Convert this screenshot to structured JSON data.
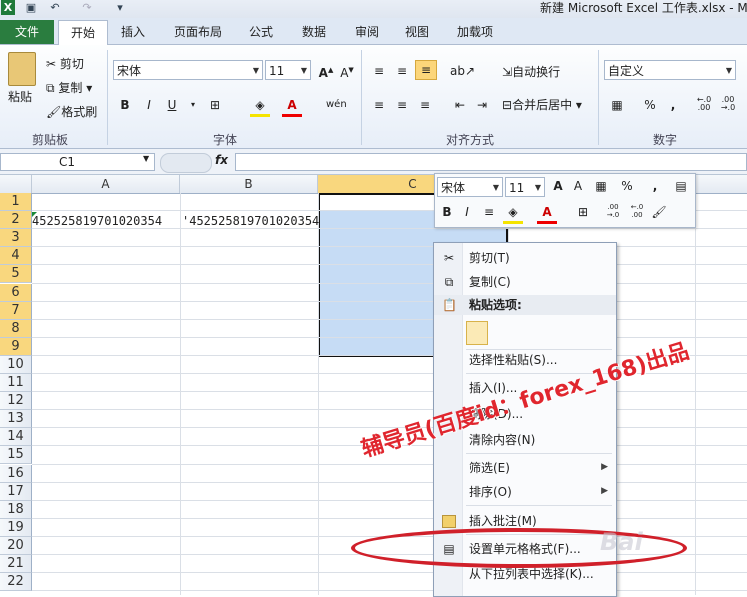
{
  "window": {
    "title": "新建 Microsoft Excel 工作表.xlsx - M"
  },
  "tabs": [
    "文件",
    "开始",
    "插入",
    "页面布局",
    "公式",
    "数据",
    "审阅",
    "视图",
    "加载项"
  ],
  "clipboard": {
    "paste": "粘贴",
    "cut": "剪切",
    "copy": "复制",
    "format_painter": "格式刷",
    "group": "剪贴板"
  },
  "font": {
    "name": "宋体",
    "size": "11",
    "group": "字体",
    "bold": "B",
    "italic": "I",
    "underline": "U",
    "wen": "wén"
  },
  "alignment": {
    "wrap": "自动换行",
    "merge": "合并后居中",
    "group": "对齐方式"
  },
  "number": {
    "format": "自定义",
    "group": "数字",
    "percent": "%",
    "comma": ",",
    "inc_dec": "+.0\n.00",
    "dec_dec": ".00\n→.0"
  },
  "formula_bar": {
    "name_box": "C1",
    "fx": "fx",
    "value": ""
  },
  "columns": [
    "A",
    "B",
    "C"
  ],
  "rows": [
    "1",
    "2",
    "3",
    "4",
    "5",
    "6",
    "7",
    "8",
    "9",
    "10",
    "11",
    "12",
    "13",
    "14",
    "15",
    "16",
    "17",
    "18",
    "19",
    "20",
    "21",
    "22"
  ],
  "cells": {
    "A2": "452525819701020354",
    "B2": "'452525819701020354"
  },
  "mini_toolbar": {
    "font": "宋体",
    "size": "11"
  },
  "context_menu": {
    "cut": "剪切(T)",
    "copy": "复制(C)",
    "paste_options": "粘贴选项:",
    "paste_special": "选择性粘贴(S)...",
    "insert": "插入(I)...",
    "delete": "删除(D)...",
    "clear": "清除内容(N)",
    "filter": "筛选(E)",
    "sort": "排序(O)",
    "insert_comment": "插入批注(M)",
    "format_cells": "设置单元格格式(F)...",
    "pick_list": "从下拉列表中选择(K)..."
  },
  "watermark": {
    "text": "辅导员(百度id：forex_168)出品"
  },
  "colors": {
    "file_tab": "#2a7d3f",
    "selection": "#c6dcf5",
    "row_highlight": "#f9d77e",
    "annotation": "#d0202a"
  }
}
